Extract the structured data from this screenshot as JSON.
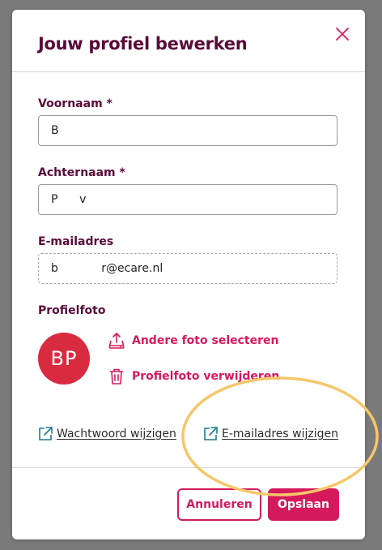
{
  "dialog": {
    "title": "Jouw profiel bewerken",
    "close_icon": "close-icon"
  },
  "form": {
    "first_name": {
      "label": "Voornaam *",
      "value": "B"
    },
    "last_name": {
      "label": "Achternaam *",
      "value": "P      v"
    },
    "email": {
      "label": "E-mailadres",
      "value": "b            r@ecare.nl"
    }
  },
  "profile_photo": {
    "label": "Profielfoto",
    "initials": "BP",
    "avatar_color": "#d92b3f",
    "select_label": "Andere foto selecteren",
    "select_icon": "upload-icon",
    "remove_label": "Profielfoto verwijderen",
    "remove_icon": "trash-icon"
  },
  "links": {
    "change_password": "Wachtwoord wijzigen",
    "change_email": "E-mailadres wijzigen",
    "icon": "external-link-icon"
  },
  "footer": {
    "cancel_label": "Annuleren",
    "save_label": "Opslaan"
  },
  "colors": {
    "heading": "#5a0b3a",
    "accent": "#d51a5c",
    "highlight": "#f5c76a"
  }
}
